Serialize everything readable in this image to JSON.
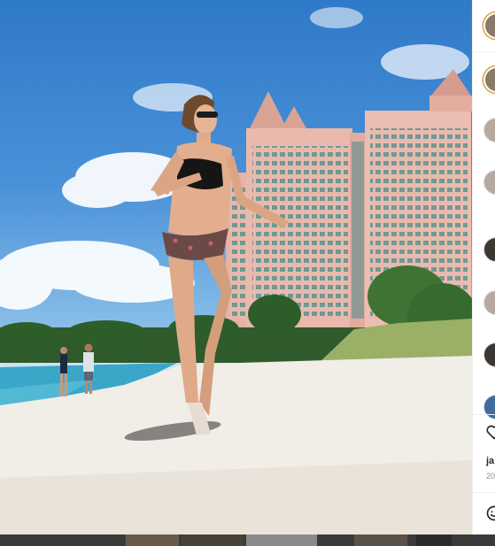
{
  "post": {
    "image_alt": "",
    "colors": {
      "sky": "#3f88d4",
      "sand": "#f2eee8",
      "water": "#3aa7c9",
      "hotel": "#e8b6ab"
    }
  },
  "panel": {
    "avatars": [
      {
        "kind": "story"
      },
      {
        "kind": "story"
      },
      {
        "kind": "plain"
      },
      {
        "kind": "plain"
      },
      {
        "kind": "dark"
      },
      {
        "kind": "plain"
      },
      {
        "kind": "dark"
      },
      {
        "kind": "blue"
      }
    ],
    "actions": {
      "like_icon": "heart-icon",
      "emoji_icon": "emoji-icon"
    },
    "owner_partial": "ja",
    "date_partial": "20"
  }
}
